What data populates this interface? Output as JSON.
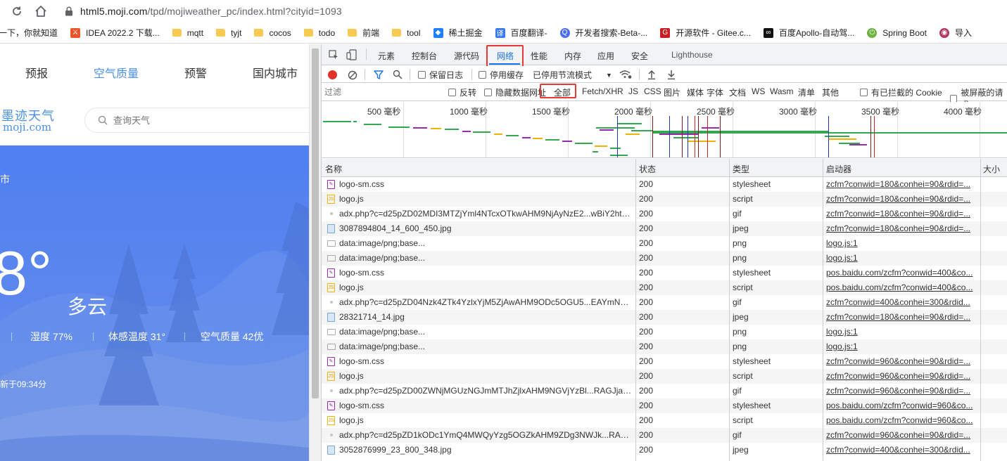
{
  "browser": {
    "url_host": "html5.moji.com",
    "url_path": "/tpd/mojiweather_pc/index.html?cityid=1093",
    "bookmarks": [
      {
        "label": "一下，你就知道",
        "icon": "none"
      },
      {
        "label": "IDEA 2022.2 下载...",
        "icon": "idea-icon"
      },
      {
        "label": "mqtt",
        "icon": "folder-icon"
      },
      {
        "label": "tyjt",
        "icon": "folder-icon"
      },
      {
        "label": "cocos",
        "icon": "folder-icon"
      },
      {
        "label": "todo",
        "icon": "folder-icon"
      },
      {
        "label": "前端",
        "icon": "folder-icon"
      },
      {
        "label": "tool",
        "icon": "folder-icon"
      },
      {
        "label": "稀土掘金",
        "icon": "juejin-icon"
      },
      {
        "label": "百度翻译-",
        "icon": "baidu-translate-icon"
      },
      {
        "label": "开发者搜索-Beta-...",
        "icon": "dev-search-icon"
      },
      {
        "label": "开源软件 - Gitee.c...",
        "icon": "gitee-icon"
      },
      {
        "label": "百度Apollo-自动驾...",
        "icon": "apollo-icon"
      },
      {
        "label": "Spring Boot",
        "icon": "spring-icon"
      },
      {
        "label": "导入",
        "icon": "import-icon"
      }
    ]
  },
  "weather_page": {
    "nav": [
      "预报",
      "空气质量",
      "预警",
      "国内城市"
    ],
    "logo_cn": "墨迹天气",
    "logo_en": "moji.com",
    "search_placeholder": "查询天气",
    "city": "市",
    "temperature": "8°",
    "condition": "多云",
    "humidity": "湿度 77%",
    "feels_like": "体感温度 31°",
    "aqi": "空气质量 42优",
    "updated": "新于09:34分"
  },
  "devtools": {
    "tabs": [
      "元素",
      "控制台",
      "源代码",
      "网络",
      "性能",
      "内存",
      "应用",
      "安全",
      "Lighthouse"
    ],
    "active_tab": "网络",
    "toolbar": {
      "preserve_log": "保留日志",
      "disable_cache": "停用缓存",
      "throttle": "已停用节流模式"
    },
    "filter": {
      "placeholder": "过滤",
      "invert": "反转",
      "hide_data_urls": "隐藏数据网址",
      "types": [
        "全部",
        "Fetch/XHR",
        "JS",
        "CSS",
        "图片",
        "媒体",
        "字体",
        "文档",
        "WS",
        "Wasm",
        "清单",
        "其他"
      ],
      "blocked_cookies": "有已拦截的 Cookie",
      "blocked_requests": "被屏蔽的请求"
    },
    "overview_ticks": [
      "500 毫秒",
      "1000 毫秒",
      "1500 毫秒",
      "2000 毫秒",
      "2500 毫秒",
      "3000 毫秒",
      "3500 毫秒",
      "4000 毫秒"
    ],
    "columns": [
      "名称",
      "状态",
      "类型",
      "启动器",
      "大小"
    ],
    "rows": [
      {
        "name": "logo-sm.css",
        "icon": "css",
        "status": "200",
        "type": "stylesheet",
        "initiator": "zcfm?conwid=180&conhei=90&rdid=..."
      },
      {
        "name": "logo.js",
        "icon": "js",
        "status": "200",
        "type": "script",
        "initiator": "zcfm?conwid=180&conhei=90&rdid=..."
      },
      {
        "name": "adx.php?c=d25pZD02MDI3MTZjYml4NTcxOTkwAHM9NjAyNzE2...wBiY2htZD...",
        "icon": "gif",
        "status": "200",
        "type": "gif",
        "initiator": "zcfm?conwid=180&conhei=90&rdid=..."
      },
      {
        "name": "3087894804_14_600_450.jpg",
        "icon": "img",
        "status": "200",
        "type": "jpeg",
        "initiator": "zcfm?conwid=180&conhei=90&rdid=..."
      },
      {
        "name": "data:image/png;base...",
        "icon": "png",
        "status": "200",
        "type": "png",
        "initiator": "logo.js:1"
      },
      {
        "name": "data:image/png;base...",
        "icon": "png",
        "status": "200",
        "type": "png",
        "initiator": "logo.js:1"
      },
      {
        "name": "logo-sm.css",
        "icon": "css",
        "status": "200",
        "type": "stylesheet",
        "initiator": "pos.baidu.com/zcfm?conwid=400&co..."
      },
      {
        "name": "logo.js",
        "icon": "js",
        "status": "200",
        "type": "script",
        "initiator": "pos.baidu.com/zcfm?conwid=400&co..."
      },
      {
        "name": "adx.php?c=d25pZD04Nzk4ZTk4YzlxYjM5ZjAwAHM9ODc5OGU5...EAYmNob...",
        "icon": "gif",
        "status": "200",
        "type": "gif",
        "initiator": "zcfm?conwid=400&conhei=300&rdid..."
      },
      {
        "name": "28321714_14.jpg",
        "icon": "img",
        "status": "200",
        "type": "jpeg",
        "initiator": "zcfm?conwid=180&conhei=90&rdid=..."
      },
      {
        "name": "data:image/png;base...",
        "icon": "png",
        "status": "200",
        "type": "png",
        "initiator": "logo.js:1"
      },
      {
        "name": "data:image/png;base...",
        "icon": "png",
        "status": "200",
        "type": "png",
        "initiator": "logo.js:1"
      },
      {
        "name": "logo-sm.css",
        "icon": "css",
        "status": "200",
        "type": "stylesheet",
        "initiator": "zcfm?conwid=960&conhei=90&rdid=..."
      },
      {
        "name": "logo.js",
        "icon": "js",
        "status": "200",
        "type": "script",
        "initiator": "zcfm?conwid=960&conhei=90&rdid=..."
      },
      {
        "name": "adx.php?c=d25pZD00ZWNjMGUzNGJmMTJhZjlxAHM9NGVjYzBl...RAGJjaG1k...",
        "icon": "gif",
        "status": "200",
        "type": "gif",
        "initiator": "zcfm?conwid=960&conhei=90&rdid=..."
      },
      {
        "name": "logo-sm.css",
        "icon": "css",
        "status": "200",
        "type": "stylesheet",
        "initiator": "pos.baidu.com/zcfm?conwid=960&co..."
      },
      {
        "name": "logo.js",
        "icon": "js",
        "status": "200",
        "type": "script",
        "initiator": "pos.baidu.com/zcfm?conwid=960&co..."
      },
      {
        "name": "adx.php?c=d25pZD1kODc1YmQ4MWQyYzg5OGZkAHM9ZDg3NWJk...RAGJj...",
        "icon": "gif",
        "status": "200",
        "type": "gif",
        "initiator": "zcfm?conwid=960&conhei=90&rdid=..."
      },
      {
        "name": "3052876999_23_800_348.jpg",
        "icon": "img",
        "status": "200",
        "type": "jpeg",
        "initiator": "zcfm?conwid=400&conhei=300&rdid..."
      }
    ]
  }
}
